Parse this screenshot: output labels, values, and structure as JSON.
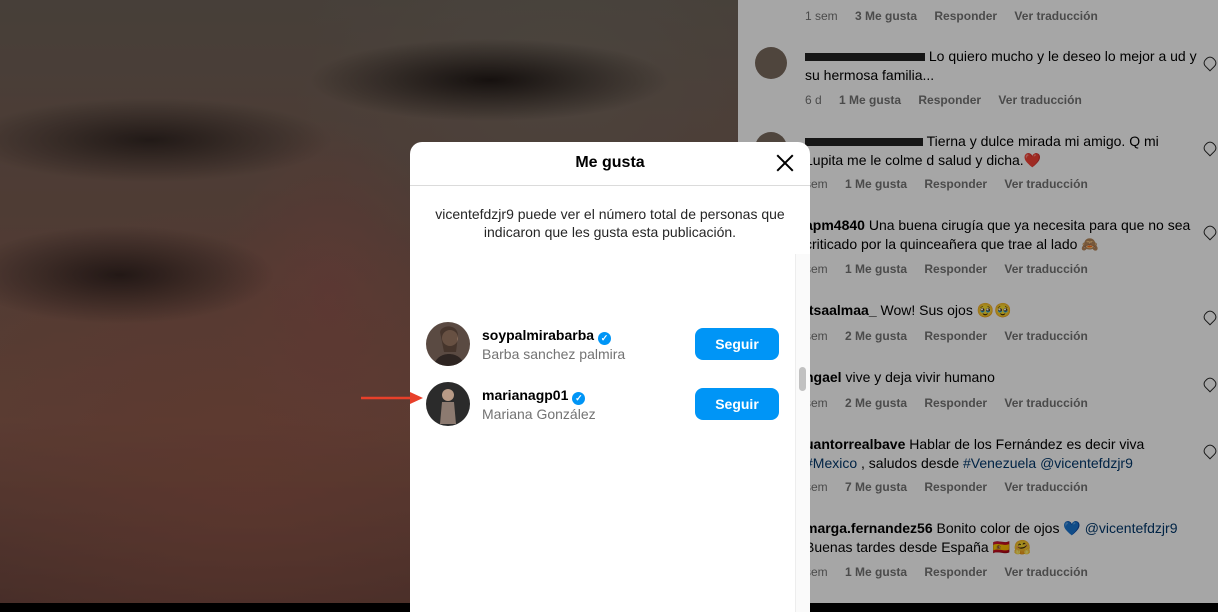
{
  "modal": {
    "title": "Me gusta",
    "notice": "vicentefdzjr9 puede ver el número total de personas que indicaron que les gusta esta publicación.",
    "users": [
      {
        "username": "soypalmirabarba",
        "fullname": "Barba sanchez palmira",
        "verified": true,
        "button": "Seguir"
      },
      {
        "username": "marianagp01",
        "fullname": "Mariana González",
        "verified": true,
        "button": "Seguir"
      }
    ]
  },
  "comments": [
    {
      "user": "",
      "text": "",
      "time": "1 sem",
      "likes": "3 Me gusta",
      "reply": "Responder",
      "translate": "Ver traducción"
    },
    {
      "user": "",
      "text": " Lo quiero mucho y le deseo lo mejor a ud y su hermosa familia...",
      "time": "6 d",
      "likes": "1 Me gusta",
      "reply": "Responder",
      "translate": "Ver traducción"
    },
    {
      "user": "",
      "text": " Tierna y dulce mirada mi amigo. Q mi Lupita me le colme d salud y dicha.❤️",
      "time": "sem",
      "likes": "1 Me gusta",
      "reply": "Responder",
      "translate": "Ver traducción"
    },
    {
      "user": "apm4840",
      "text": " Una buena cirugía que ya necesita para que no sea criticado por la quinceañera que trae al lado 🙈",
      "time": "sem",
      "likes": "1 Me gusta",
      "reply": "Responder",
      "translate": "Ver traducción"
    },
    {
      "user": "itsaalmaa_",
      "text": " Wow! Sus ojos 🥹🥹",
      "time": "sem",
      "likes": "2 Me gusta",
      "reply": "Responder",
      "translate": "Ver traducción"
    },
    {
      "user": "ngael",
      "text": " vive y deja vivir humano",
      "time": "sem",
      "likes": "2 Me gusta",
      "reply": "Responder",
      "translate": "Ver traducción"
    },
    {
      "user": "uantorrealbave",
      "text": " Hablar de los Fernández es decir viva ",
      "tags": "#Mexico",
      "text2": " , saludos desde ",
      "tags2": "#Venezuela @vicentefdzjr9",
      "time": "sem",
      "likes": "7 Me gusta",
      "reply": "Responder",
      "translate": "Ver traducción"
    },
    {
      "user": "marga.fernandez56",
      "text": " Bonito color de ojos 💙 ",
      "tags": "@vicentefdzjr9",
      "text2": " Buenas tardes desde España 🇪🇸 🤗",
      "time": "sem",
      "likes": "1 Me gusta",
      "reply": "Responder",
      "translate": "Ver traducción"
    }
  ],
  "colors": {
    "accent": "#0095f6",
    "arrow": "#e8402a"
  }
}
